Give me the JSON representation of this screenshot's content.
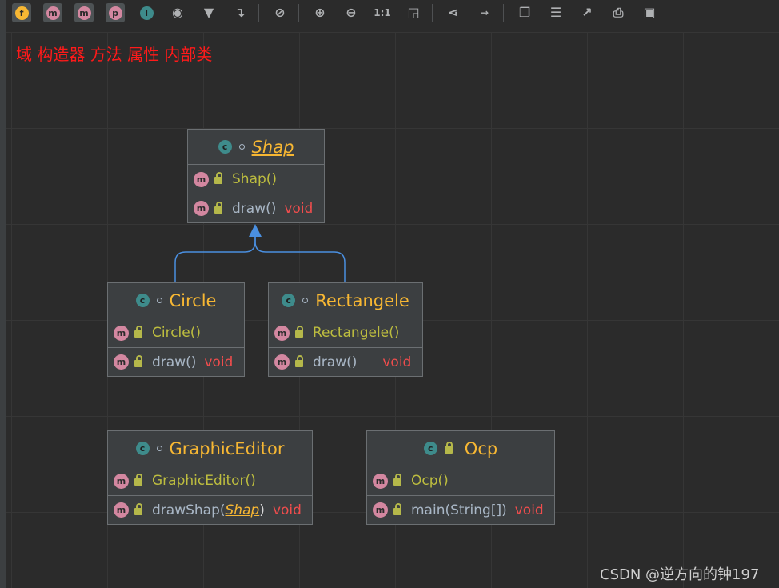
{
  "toolbar": {
    "toggles": [
      {
        "name": "fields-toggle",
        "letter": "f",
        "color": "#f7b733"
      },
      {
        "name": "constructors-toggle",
        "letter": "m",
        "color": "#d387a0"
      },
      {
        "name": "methods-toggle",
        "letter": "m",
        "color": "#d387a0"
      },
      {
        "name": "properties-toggle",
        "letter": "p",
        "color": "#d387a0"
      },
      {
        "name": "inner-classes-toggle",
        "letter": "I",
        "color": "#3e8b8b"
      }
    ],
    "icons": [
      "eye-icon",
      "filter-icon",
      "route-icon",
      "link-icon",
      "zoom-in-icon",
      "zoom-out-icon",
      "actual-size-icon",
      "fit-content-icon",
      "layout-icon",
      "apply-layout-icon",
      "copy-icon",
      "format-icon",
      "export-icon",
      "print-icon",
      "save-icon"
    ],
    "actual_size_label": "1:1"
  },
  "category_label": "域 构造器 方法 属性 内部类",
  "colors": {
    "class_title": "#f7b733",
    "method_name": "#bdbd3f",
    "return_type": "#f04d4d",
    "edge": "#4a8fe0",
    "category_label": "#ff1a1a"
  },
  "diagram": {
    "classes": [
      {
        "name": "Shap",
        "abstract": true,
        "members": [
          {
            "name": "Shap()"
          },
          {
            "name": "draw()",
            "ret": "void"
          }
        ]
      },
      {
        "name": "Circle",
        "members": [
          {
            "name": "Circle()"
          },
          {
            "name": "draw()",
            "ret": "void"
          }
        ]
      },
      {
        "name": "Rectangele",
        "members": [
          {
            "name": "Rectangele()"
          },
          {
            "name": "draw()",
            "ret": "void"
          }
        ]
      },
      {
        "name": "GraphicEditor",
        "members": [
          {
            "name": "GraphicEditor()"
          },
          {
            "name": "drawShap(",
            "param": "Shap",
            "close": ")",
            "ret": "void"
          }
        ]
      },
      {
        "name": "Ocp",
        "members": [
          {
            "name": "Ocp()"
          },
          {
            "name": "main(String[])",
            "ret": "void"
          }
        ]
      }
    ],
    "edges": [
      {
        "from": "Circle",
        "to": "Shap",
        "type": "inheritance"
      },
      {
        "from": "Rectangele",
        "to": "Shap",
        "type": "inheritance"
      }
    ],
    "icon_letters": {
      "class": "c",
      "method": "m"
    }
  },
  "watermark": "CSDN @逆方向的钟197"
}
